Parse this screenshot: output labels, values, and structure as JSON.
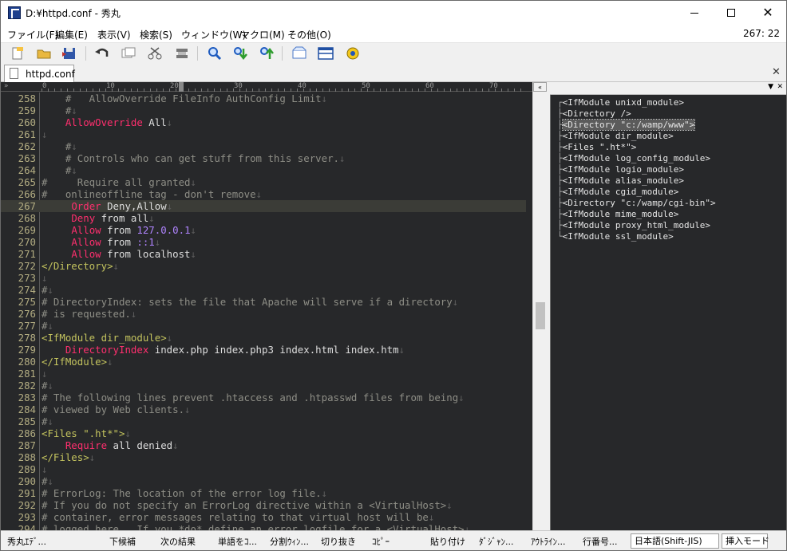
{
  "window": {
    "title": "D:¥httpd.conf - 秀丸",
    "cursor_position": "267: 22"
  },
  "menu": [
    "ファイル(F)",
    "編集(E)",
    "表示(V)",
    "検索(S)",
    "ウィンドウ(W)",
    "マクロ(M)",
    "その他(O)"
  ],
  "tab": {
    "label": "httpd.conf"
  },
  "ruler": {
    "marks": [
      "0",
      "10",
      "20",
      "30",
      "40",
      "50",
      "60",
      "70"
    ]
  },
  "editor": {
    "current_line": "267",
    "lines": [
      {
        "n": "258",
        "t": "    #   AllowOverride FileInfo AuthConfig Limit"
      },
      {
        "n": "259",
        "t": "    #"
      },
      {
        "n": "260",
        "t": "    AllowOverride All"
      },
      {
        "n": "261",
        "t": ""
      },
      {
        "n": "262",
        "t": "    #"
      },
      {
        "n": "263",
        "t": "    # Controls who can get stuff from this server."
      },
      {
        "n": "264",
        "t": "    #"
      },
      {
        "n": "265",
        "t": "#     Require all granted"
      },
      {
        "n": "266",
        "t": "#   onlineoffline tag - don't remove"
      },
      {
        "n": "267",
        "t": "     Order Deny,Allow"
      },
      {
        "n": "268",
        "t": "     Deny from all"
      },
      {
        "n": "269",
        "t": "     Allow from 127.0.0.1"
      },
      {
        "n": "270",
        "t": "     Allow from ::1"
      },
      {
        "n": "271",
        "t": "     Allow from localhost"
      },
      {
        "n": "272",
        "t": "</Directory>"
      },
      {
        "n": "273",
        "t": ""
      },
      {
        "n": "274",
        "t": "#"
      },
      {
        "n": "275",
        "t": "# DirectoryIndex: sets the file that Apache will serve if a directory"
      },
      {
        "n": "276",
        "t": "# is requested."
      },
      {
        "n": "277",
        "t": "#"
      },
      {
        "n": "278",
        "t": "<IfModule dir_module>"
      },
      {
        "n": "279",
        "t": "    DirectoryIndex index.php index.php3 index.html index.htm"
      },
      {
        "n": "280",
        "t": "</IfModule>"
      },
      {
        "n": "281",
        "t": ""
      },
      {
        "n": "282",
        "t": "#"
      },
      {
        "n": "283",
        "t": "# The following lines prevent .htaccess and .htpasswd files from being"
      },
      {
        "n": "284",
        "t": "# viewed by Web clients."
      },
      {
        "n": "285",
        "t": "#"
      },
      {
        "n": "286",
        "t": "<Files \".ht*\">"
      },
      {
        "n": "287",
        "t": "    Require all denied"
      },
      {
        "n": "288",
        "t": "</Files>"
      },
      {
        "n": "289",
        "t": ""
      },
      {
        "n": "290",
        "t": "#"
      },
      {
        "n": "291",
        "t": "# ErrorLog: The location of the error log file."
      },
      {
        "n": "292",
        "t": "# If you do not specify an ErrorLog directive within a <VirtualHost>"
      },
      {
        "n": "293",
        "t": "# container, error messages relating to that virtual host will be"
      },
      {
        "n": "294",
        "t": "# logged here.  If you *do* define an error logfile for a <VirtualHost>"
      }
    ]
  },
  "outline": {
    "selected_index": 2,
    "items": [
      "<IfModule unixd_module>",
      "<Directory />",
      "<Directory \"c:/wamp/www\">",
      "<IfModule dir_module>",
      "<Files \".ht*\">",
      "<IfModule log_config_module>",
      "<IfModule logio_module>",
      "<IfModule alias_module>",
      "<IfModule cgid_module>",
      "<Directory \"c:/wamp/cgi-bin\">",
      "<IfModule mime_module>",
      "<IfModule proxy_html_module>",
      "<IfModule ssl_module>"
    ]
  },
  "statusbar": {
    "items": [
      "秀丸ｴﾃﾞ...",
      "下候補",
      "次の結果",
      "単語をｺ...",
      "分割ｳｨﾝ...",
      "切り抜き",
      "ｺﾋﾟｰ",
      "貼り付け",
      "ﾀﾞｼﾞｬﾝ...",
      "ｱｳﾄﾗｲﾝ...",
      "行番号..."
    ],
    "encoding": "日本語(Shift-JIS)",
    "mode": "挿入モード"
  },
  "icons": {
    "toolbar": [
      "new-file-icon",
      "open-folder-icon",
      "save-icon",
      "undo-icon",
      "copy-window-icon",
      "cut-icon",
      "paste-icon",
      "search-icon",
      "search-down-icon",
      "search-up-icon",
      "tag-jump-icon",
      "split-window-icon",
      "macro-icon"
    ]
  },
  "colors": {
    "editor_bg": "#27282a",
    "comment": "#8e8e86",
    "keyword": "#ff2f6e",
    "tag": "#c3c35e",
    "number": "#b084ff",
    "line_number": "#b3ad82"
  }
}
